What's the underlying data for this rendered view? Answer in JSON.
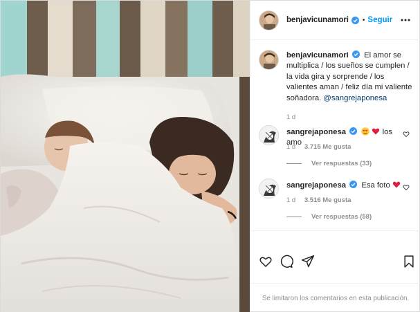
{
  "post": {
    "username": "benjavicunamori",
    "follow_label": "Seguir",
    "separator": "•",
    "caption": {
      "username": "benjavicunamori",
      "text": "El amor se multiplica / los sueños se cumplen / la vida gira y sorprende / los valientes aman / feliz día mi valiente soñadora.",
      "mention": "@sangrejaponesa",
      "age": "1 d"
    },
    "comments": [
      {
        "username": "sangrejaponesa",
        "text": "los amo",
        "emojis": [
          "heart-eyes-emoji",
          "red-heart-emoji"
        ],
        "age": "1 d",
        "likes": "3.715 Me gusta",
        "replies": "Ver respuestas (33)"
      },
      {
        "username": "sangrejaponesa",
        "text": "Esa foto",
        "emojis": [
          "red-heart-emoji"
        ],
        "age": "1 d",
        "likes": "3.516 Me gusta",
        "replies": "Ver respuestas (58)"
      }
    ],
    "actions": [
      "heart-icon",
      "comment-icon",
      "share-icon",
      "bookmark-icon"
    ],
    "footer": "Se limitaron los comentarios en esta publicación."
  },
  "colors": {
    "link_blue": "#0095f6",
    "mention_blue": "#00376b",
    "secondary_text": "#8e8e8e",
    "primary_text": "#262626",
    "heart_red": "#e0245e",
    "border": "#efefef"
  }
}
